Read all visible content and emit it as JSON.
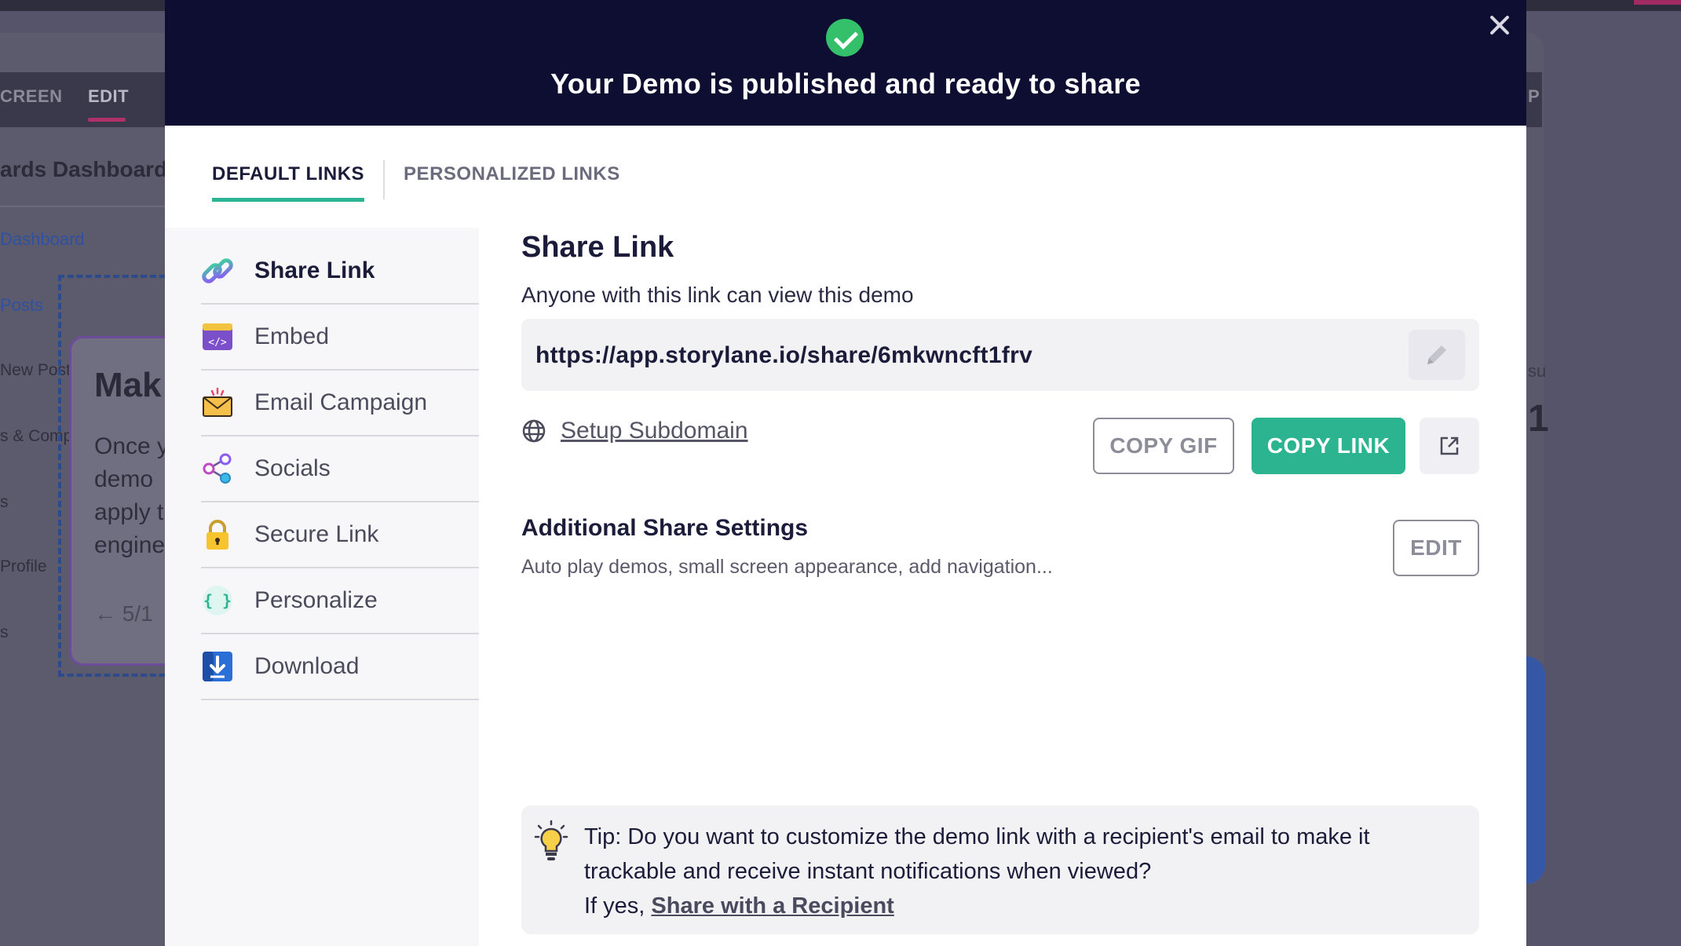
{
  "background": {
    "tabs": [
      "CREEN",
      "EDIT"
    ],
    "title": "ards Dashboard",
    "links": [
      "Dashboard",
      "Posts"
    ],
    "sidebar": [
      "New Post",
      "s & Comp",
      "s",
      "Profile",
      "s"
    ],
    "card": {
      "title": "Mak",
      "lines": [
        "Once y",
        "demo",
        "apply t",
        "engine"
      ],
      "nav": "5/1"
    },
    "right_fragments": [
      "P",
      "su",
      "1"
    ]
  },
  "modal": {
    "header_title": "Your Demo is published and ready to share",
    "tabs": [
      {
        "label": "DEFAULT LINKS",
        "active": true
      },
      {
        "label": "PERSONALIZED LINKS",
        "active": false
      }
    ],
    "menu": [
      {
        "label": "Share Link",
        "icon": "link-icon",
        "active": true
      },
      {
        "label": "Embed",
        "icon": "embed-code-icon",
        "active": false
      },
      {
        "label": "Email Campaign",
        "icon": "email-icon",
        "active": false
      },
      {
        "label": "Socials",
        "icon": "share-nodes-icon",
        "active": false
      },
      {
        "label": "Secure Link",
        "icon": "lock-icon",
        "active": false
      },
      {
        "label": "Personalize",
        "icon": "curly-braces-icon",
        "active": false
      },
      {
        "label": "Download",
        "icon": "download-icon",
        "active": false
      }
    ],
    "share": {
      "title": "Share Link",
      "subtitle": "Anyone with this link can view this demo",
      "url": "https://app.storylane.io/share/6mkwncft1frv",
      "subdomain_label": "Setup Subdomain",
      "copy_gif": "COPY GIF",
      "copy_link": "COPY LINK"
    },
    "additional": {
      "title": "Additional Share Settings",
      "subtitle": "Auto play demos, small screen appearance, add navigation...",
      "edit_label": "EDIT"
    },
    "tip": {
      "text": "Tip: Do you want to customize the demo link with a recipient's email to make it trackable and receive instant notifications when viewed?",
      "prefix": "If yes, ",
      "link": "Share with a Recipient"
    }
  },
  "colors": {
    "header_bg": "#0e0e33",
    "accent_green": "#2cb38f",
    "success": "#34c06a"
  }
}
